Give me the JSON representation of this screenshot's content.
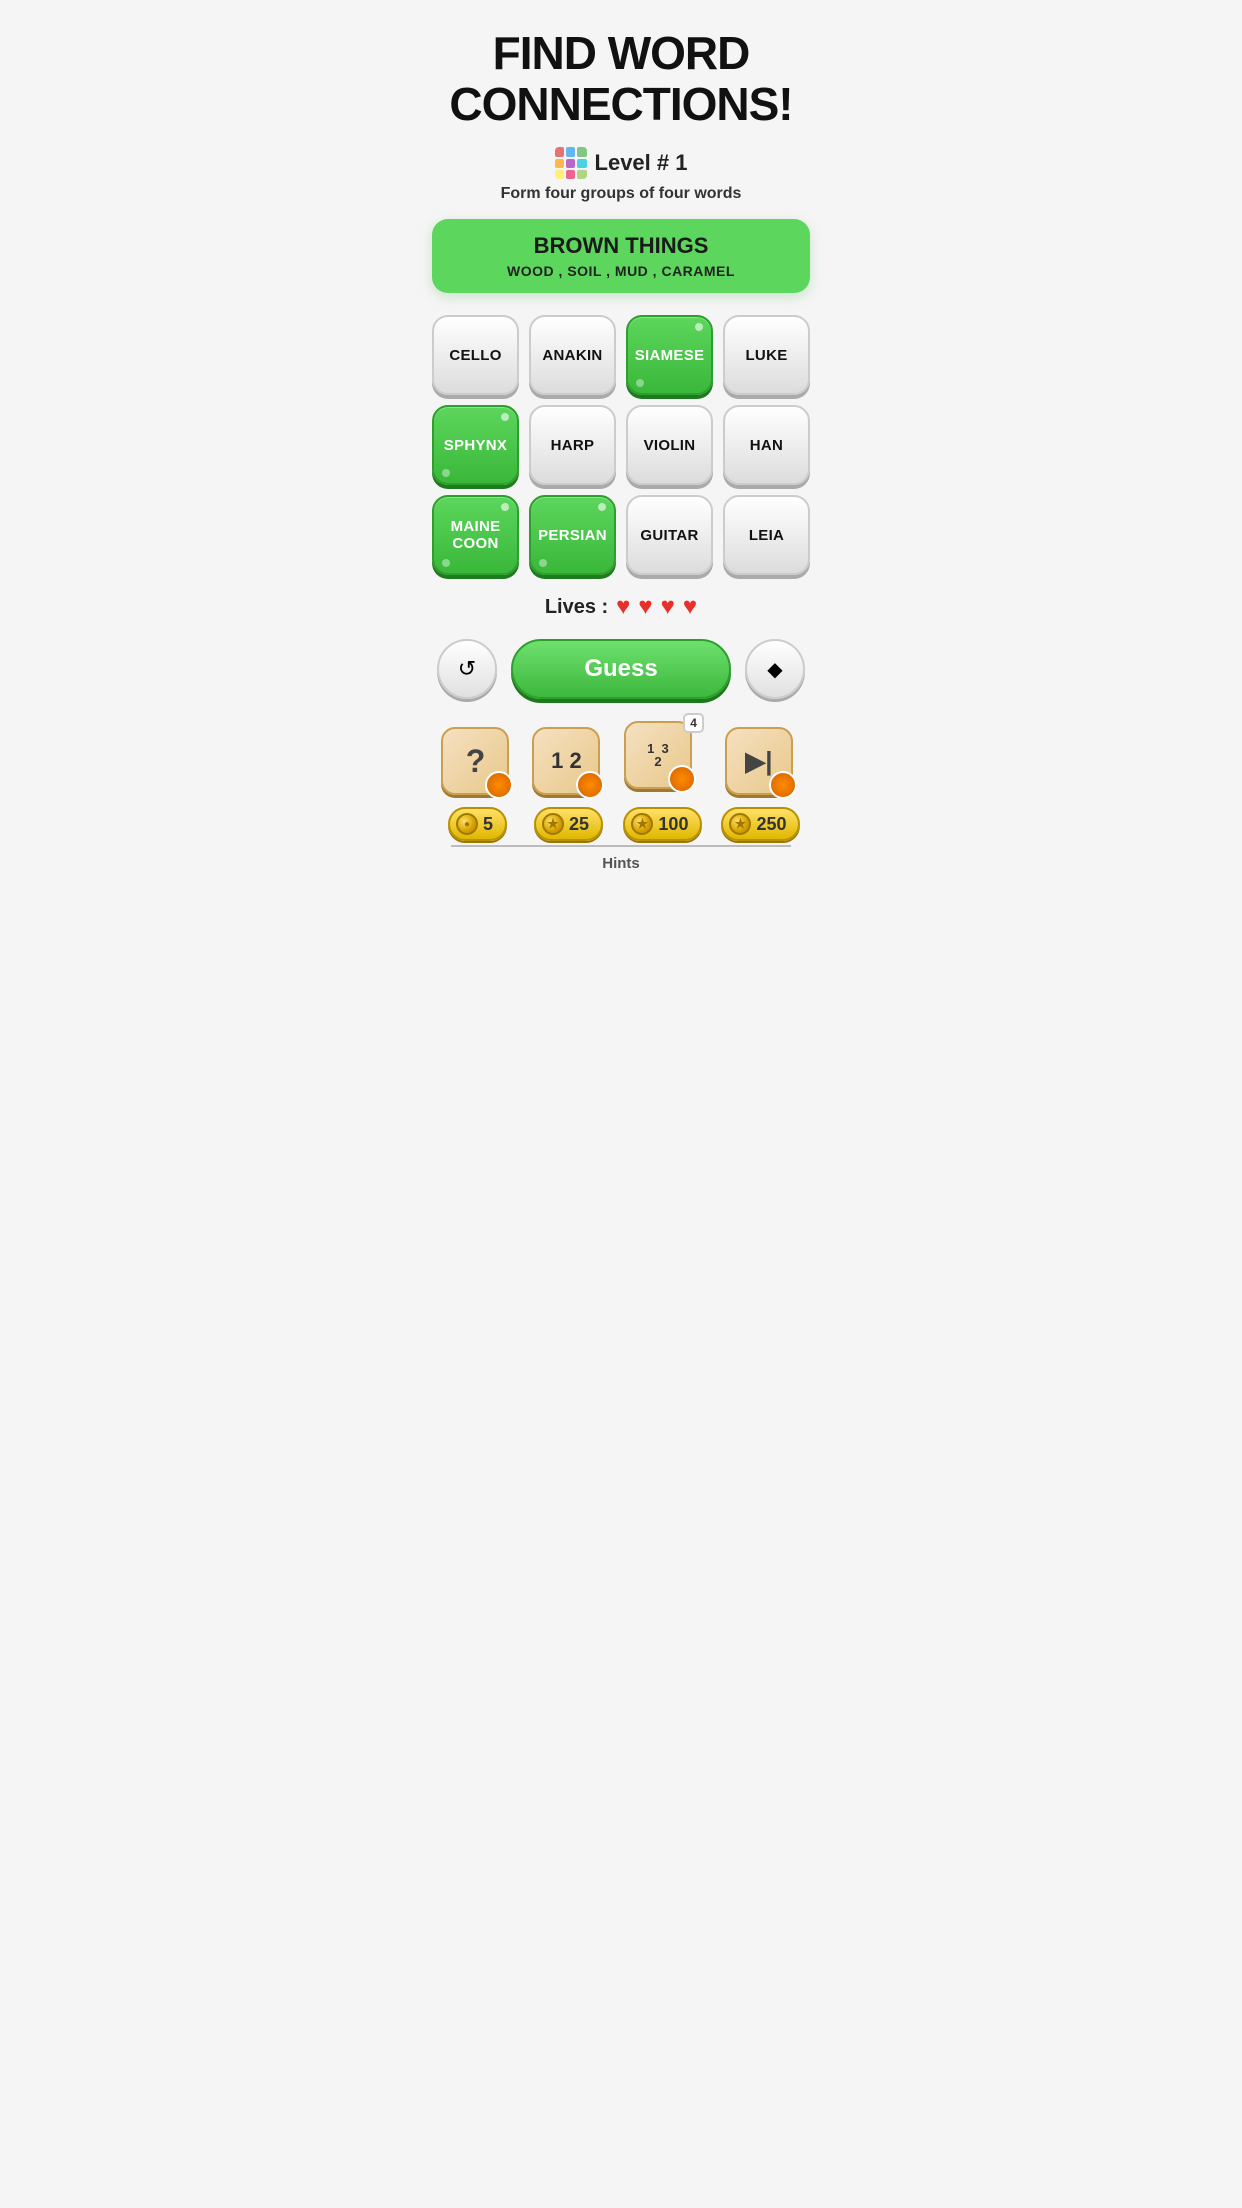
{
  "header": {
    "title": "FIND WORD\nCONNECTIONS!"
  },
  "level": {
    "icon_colors": [
      "#e57373",
      "#64b5f6",
      "#81c784",
      "#ffb74d",
      "#ba68c8",
      "#4dd0e1",
      "#fff176",
      "#f06292",
      "#aed581"
    ],
    "label": "Level # 1"
  },
  "subtitle": "Form four groups of four words",
  "category": {
    "title": "BROWN THINGS",
    "words": "WOOD , SOIL , MUD , CARAMEL"
  },
  "tiles": [
    {
      "label": "CELLO",
      "selected": false
    },
    {
      "label": "ANAKIN",
      "selected": false
    },
    {
      "label": "SIAMESE",
      "selected": true
    },
    {
      "label": "LUKE",
      "selected": false
    },
    {
      "label": "SPHYNX",
      "selected": true
    },
    {
      "label": "HARP",
      "selected": false
    },
    {
      "label": "VIOLIN",
      "selected": false
    },
    {
      "label": "HAN",
      "selected": false
    },
    {
      "label": "MAINE COON",
      "selected": true
    },
    {
      "label": "PERSIAN",
      "selected": true
    },
    {
      "label": "GUITAR",
      "selected": false
    },
    {
      "label": "LEIA",
      "selected": false
    }
  ],
  "lives": {
    "label": "Lives :",
    "count": 4,
    "heart": "♥"
  },
  "controls": {
    "shuffle_label": "↺",
    "guess_label": "Guess",
    "erase_label": "◆"
  },
  "hints": [
    {
      "symbol": "?",
      "badge_num": "",
      "overlay_nums": null,
      "cost": 5
    },
    {
      "symbol": "12",
      "badge_num": "",
      "overlay_nums": null,
      "cost": 25
    },
    {
      "symbol": "123",
      "badge_num": "",
      "overlay_nums": {
        "tl": "4",
        "br": null
      },
      "cost": 100
    },
    {
      "symbol": "▶|",
      "badge_num": "",
      "overlay_nums": null,
      "cost": 250
    }
  ],
  "hints_label": "Hints"
}
